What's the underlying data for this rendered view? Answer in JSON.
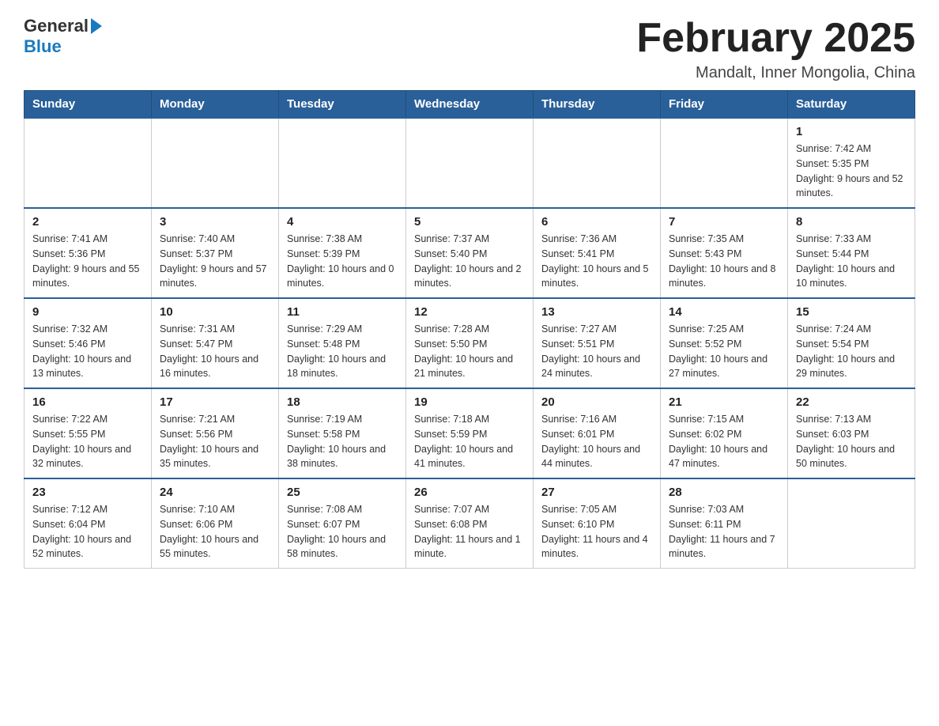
{
  "header": {
    "logo_general": "General",
    "logo_blue": "Blue",
    "month_title": "February 2025",
    "location": "Mandalt, Inner Mongolia, China"
  },
  "weekdays": [
    "Sunday",
    "Monday",
    "Tuesday",
    "Wednesday",
    "Thursday",
    "Friday",
    "Saturday"
  ],
  "weeks": [
    [
      {
        "day": "",
        "info": ""
      },
      {
        "day": "",
        "info": ""
      },
      {
        "day": "",
        "info": ""
      },
      {
        "day": "",
        "info": ""
      },
      {
        "day": "",
        "info": ""
      },
      {
        "day": "",
        "info": ""
      },
      {
        "day": "1",
        "info": "Sunrise: 7:42 AM\nSunset: 5:35 PM\nDaylight: 9 hours and 52 minutes."
      }
    ],
    [
      {
        "day": "2",
        "info": "Sunrise: 7:41 AM\nSunset: 5:36 PM\nDaylight: 9 hours and 55 minutes."
      },
      {
        "day": "3",
        "info": "Sunrise: 7:40 AM\nSunset: 5:37 PM\nDaylight: 9 hours and 57 minutes."
      },
      {
        "day": "4",
        "info": "Sunrise: 7:38 AM\nSunset: 5:39 PM\nDaylight: 10 hours and 0 minutes."
      },
      {
        "day": "5",
        "info": "Sunrise: 7:37 AM\nSunset: 5:40 PM\nDaylight: 10 hours and 2 minutes."
      },
      {
        "day": "6",
        "info": "Sunrise: 7:36 AM\nSunset: 5:41 PM\nDaylight: 10 hours and 5 minutes."
      },
      {
        "day": "7",
        "info": "Sunrise: 7:35 AM\nSunset: 5:43 PM\nDaylight: 10 hours and 8 minutes."
      },
      {
        "day": "8",
        "info": "Sunrise: 7:33 AM\nSunset: 5:44 PM\nDaylight: 10 hours and 10 minutes."
      }
    ],
    [
      {
        "day": "9",
        "info": "Sunrise: 7:32 AM\nSunset: 5:46 PM\nDaylight: 10 hours and 13 minutes."
      },
      {
        "day": "10",
        "info": "Sunrise: 7:31 AM\nSunset: 5:47 PM\nDaylight: 10 hours and 16 minutes."
      },
      {
        "day": "11",
        "info": "Sunrise: 7:29 AM\nSunset: 5:48 PM\nDaylight: 10 hours and 18 minutes."
      },
      {
        "day": "12",
        "info": "Sunrise: 7:28 AM\nSunset: 5:50 PM\nDaylight: 10 hours and 21 minutes."
      },
      {
        "day": "13",
        "info": "Sunrise: 7:27 AM\nSunset: 5:51 PM\nDaylight: 10 hours and 24 minutes."
      },
      {
        "day": "14",
        "info": "Sunrise: 7:25 AM\nSunset: 5:52 PM\nDaylight: 10 hours and 27 minutes."
      },
      {
        "day": "15",
        "info": "Sunrise: 7:24 AM\nSunset: 5:54 PM\nDaylight: 10 hours and 29 minutes."
      }
    ],
    [
      {
        "day": "16",
        "info": "Sunrise: 7:22 AM\nSunset: 5:55 PM\nDaylight: 10 hours and 32 minutes."
      },
      {
        "day": "17",
        "info": "Sunrise: 7:21 AM\nSunset: 5:56 PM\nDaylight: 10 hours and 35 minutes."
      },
      {
        "day": "18",
        "info": "Sunrise: 7:19 AM\nSunset: 5:58 PM\nDaylight: 10 hours and 38 minutes."
      },
      {
        "day": "19",
        "info": "Sunrise: 7:18 AM\nSunset: 5:59 PM\nDaylight: 10 hours and 41 minutes."
      },
      {
        "day": "20",
        "info": "Sunrise: 7:16 AM\nSunset: 6:01 PM\nDaylight: 10 hours and 44 minutes."
      },
      {
        "day": "21",
        "info": "Sunrise: 7:15 AM\nSunset: 6:02 PM\nDaylight: 10 hours and 47 minutes."
      },
      {
        "day": "22",
        "info": "Sunrise: 7:13 AM\nSunset: 6:03 PM\nDaylight: 10 hours and 50 minutes."
      }
    ],
    [
      {
        "day": "23",
        "info": "Sunrise: 7:12 AM\nSunset: 6:04 PM\nDaylight: 10 hours and 52 minutes."
      },
      {
        "day": "24",
        "info": "Sunrise: 7:10 AM\nSunset: 6:06 PM\nDaylight: 10 hours and 55 minutes."
      },
      {
        "day": "25",
        "info": "Sunrise: 7:08 AM\nSunset: 6:07 PM\nDaylight: 10 hours and 58 minutes."
      },
      {
        "day": "26",
        "info": "Sunrise: 7:07 AM\nSunset: 6:08 PM\nDaylight: 11 hours and 1 minute."
      },
      {
        "day": "27",
        "info": "Sunrise: 7:05 AM\nSunset: 6:10 PM\nDaylight: 11 hours and 4 minutes."
      },
      {
        "day": "28",
        "info": "Sunrise: 7:03 AM\nSunset: 6:11 PM\nDaylight: 11 hours and 7 minutes."
      },
      {
        "day": "",
        "info": ""
      }
    ]
  ]
}
